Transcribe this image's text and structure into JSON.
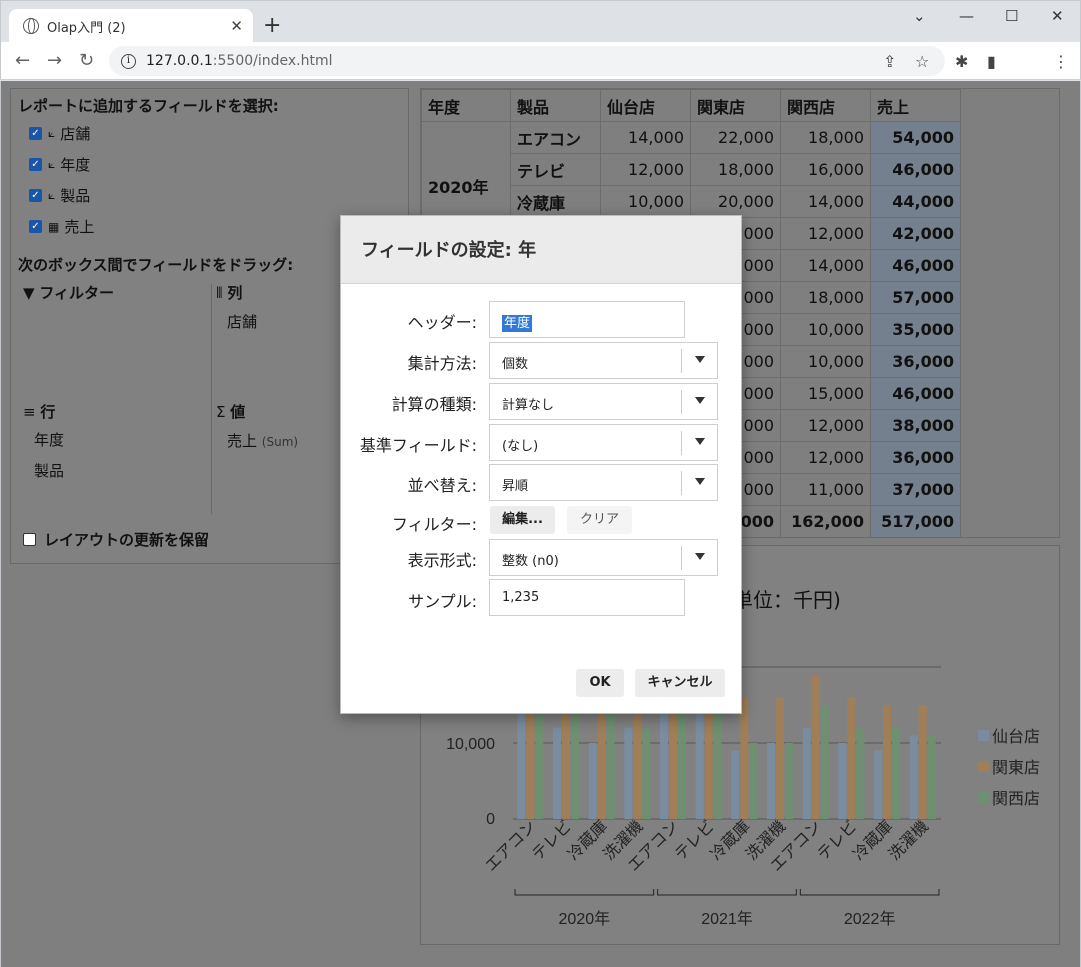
{
  "browser": {
    "tab_title": "Olap入門 (2)",
    "url_host": "127.0.0.1",
    "url_rest": ":5500/index.html"
  },
  "field_panel": {
    "select_header": "レポートに追加するフィールドを選択:",
    "fields": [
      {
        "label": "店舗",
        "checked": true
      },
      {
        "label": "年度",
        "checked": true
      },
      {
        "label": "製品",
        "checked": true
      },
      {
        "label": "売上",
        "checked": true
      }
    ],
    "drag_header": "次のボックス間でフィールドをドラッグ:",
    "zones": {
      "filter": {
        "title": "フィルター",
        "items": []
      },
      "columns": {
        "title": "列",
        "items": [
          "店舗"
        ]
      },
      "rows": {
        "title": "行",
        "items": [
          "年度",
          "製品"
        ]
      },
      "values": {
        "title": "値",
        "items": [
          "売上"
        ],
        "agg": "(Sum)"
      }
    },
    "defer_label": "レイアウトの更新を保留"
  },
  "grid": {
    "headers": [
      "年度",
      "製品",
      "仙台店",
      "関東店",
      "関西店",
      "売上"
    ],
    "group_label": "2020年",
    "rows": [
      {
        "product": "エアコン",
        "sendai": "14,000",
        "kanto": "22,000",
        "kansai": "18,000",
        "total": "54,000"
      },
      {
        "product": "テレビ",
        "sendai": "12,000",
        "kanto": "18,000",
        "kansai": "16,000",
        "total": "46,000"
      },
      {
        "product": "冷蔵庫",
        "sendai": "10,000",
        "kanto": "20,000",
        "kansai": "14,000",
        "total": "44,000"
      },
      {
        "product": "",
        "sendai": "",
        "kanto": "000",
        "kansai": "12,000",
        "total": "42,000"
      },
      {
        "product": "",
        "sendai": "",
        "kanto": "000",
        "kansai": "14,000",
        "total": "46,000"
      },
      {
        "product": "",
        "sendai": "",
        "kanto": "000",
        "kansai": "18,000",
        "total": "57,000"
      },
      {
        "product": "",
        "sendai": "",
        "kanto": "000",
        "kansai": "10,000",
        "total": "35,000"
      },
      {
        "product": "",
        "sendai": "",
        "kanto": "000",
        "kansai": "10,000",
        "total": "36,000"
      },
      {
        "product": "",
        "sendai": "",
        "kanto": "000",
        "kansai": "15,000",
        "total": "46,000"
      },
      {
        "product": "",
        "sendai": "",
        "kanto": "000",
        "kansai": "12,000",
        "total": "38,000"
      },
      {
        "product": "",
        "sendai": "",
        "kanto": "000",
        "kansai": "12,000",
        "total": "36,000"
      },
      {
        "product": "",
        "sendai": "",
        "kanto": "000",
        "kansai": "11,000",
        "total": "37,000"
      },
      {
        "product": "",
        "sendai": "",
        "kanto": "000",
        "kansai": "162,000",
        "total": "517,000"
      }
    ]
  },
  "chart": {
    "title_partial": "単位：千円)",
    "y_ticks": [
      "0",
      "10,000"
    ],
    "legend": [
      "仙台店",
      "関東店",
      "関西店"
    ],
    "colors": [
      "#7a8da0",
      "#a07e57",
      "#6e9070"
    ],
    "categories": [
      "エアコン",
      "テレビ",
      "冷蔵庫",
      "洗濯機",
      "エアコン",
      "テレビ",
      "冷蔵庫",
      "洗濯機",
      "エアコン",
      "テレビ",
      "冷蔵庫",
      "洗濯機"
    ],
    "years": [
      "2020年",
      "2021年",
      "2022年"
    ]
  },
  "chart_data": {
    "type": "bar",
    "categories": [
      "エアコン",
      "テレビ",
      "冷蔵庫",
      "洗濯機",
      "エアコン",
      "テレビ",
      "冷蔵庫",
      "洗濯機",
      "エアコン",
      "テレビ",
      "冷蔵庫",
      "洗濯機"
    ],
    "series": [
      {
        "name": "仙台店",
        "values": [
          14000,
          12000,
          10000,
          12000,
          14000,
          14000,
          9000,
          10000,
          12000,
          10000,
          9000,
          11000
        ]
      },
      {
        "name": "関東店",
        "values": [
          22000,
          18000,
          20000,
          16000,
          18000,
          18000,
          16000,
          16000,
          19000,
          16000,
          15000,
          15000
        ]
      },
      {
        "name": "関西店",
        "values": [
          18000,
          16000,
          14000,
          12000,
          14000,
          18000,
          10000,
          10000,
          15000,
          12000,
          12000,
          11000
        ]
      }
    ],
    "groups": [
      "2020年",
      "2021年",
      "2022年"
    ],
    "ylim": [
      0,
      20000
    ]
  },
  "dialog": {
    "title": "フィールドの設定: 年",
    "header_label": "ヘッダー:",
    "header_value": "年度",
    "agg_label": "集計方法:",
    "agg_value": "個数",
    "calc_label": "計算の種類:",
    "calc_value": "計算なし",
    "base_label": "基準フィールド:",
    "base_value": "(なし)",
    "sort_label": "並べ替え:",
    "sort_value": "昇順",
    "filter_label": "フィルター:",
    "filter_edit": "編集...",
    "filter_clear": "クリア",
    "format_label": "表示形式:",
    "format_value": "整数 (n0)",
    "sample_label": "サンプル:",
    "sample_value": "1,235",
    "ok": "OK",
    "cancel": "キャンセル"
  }
}
